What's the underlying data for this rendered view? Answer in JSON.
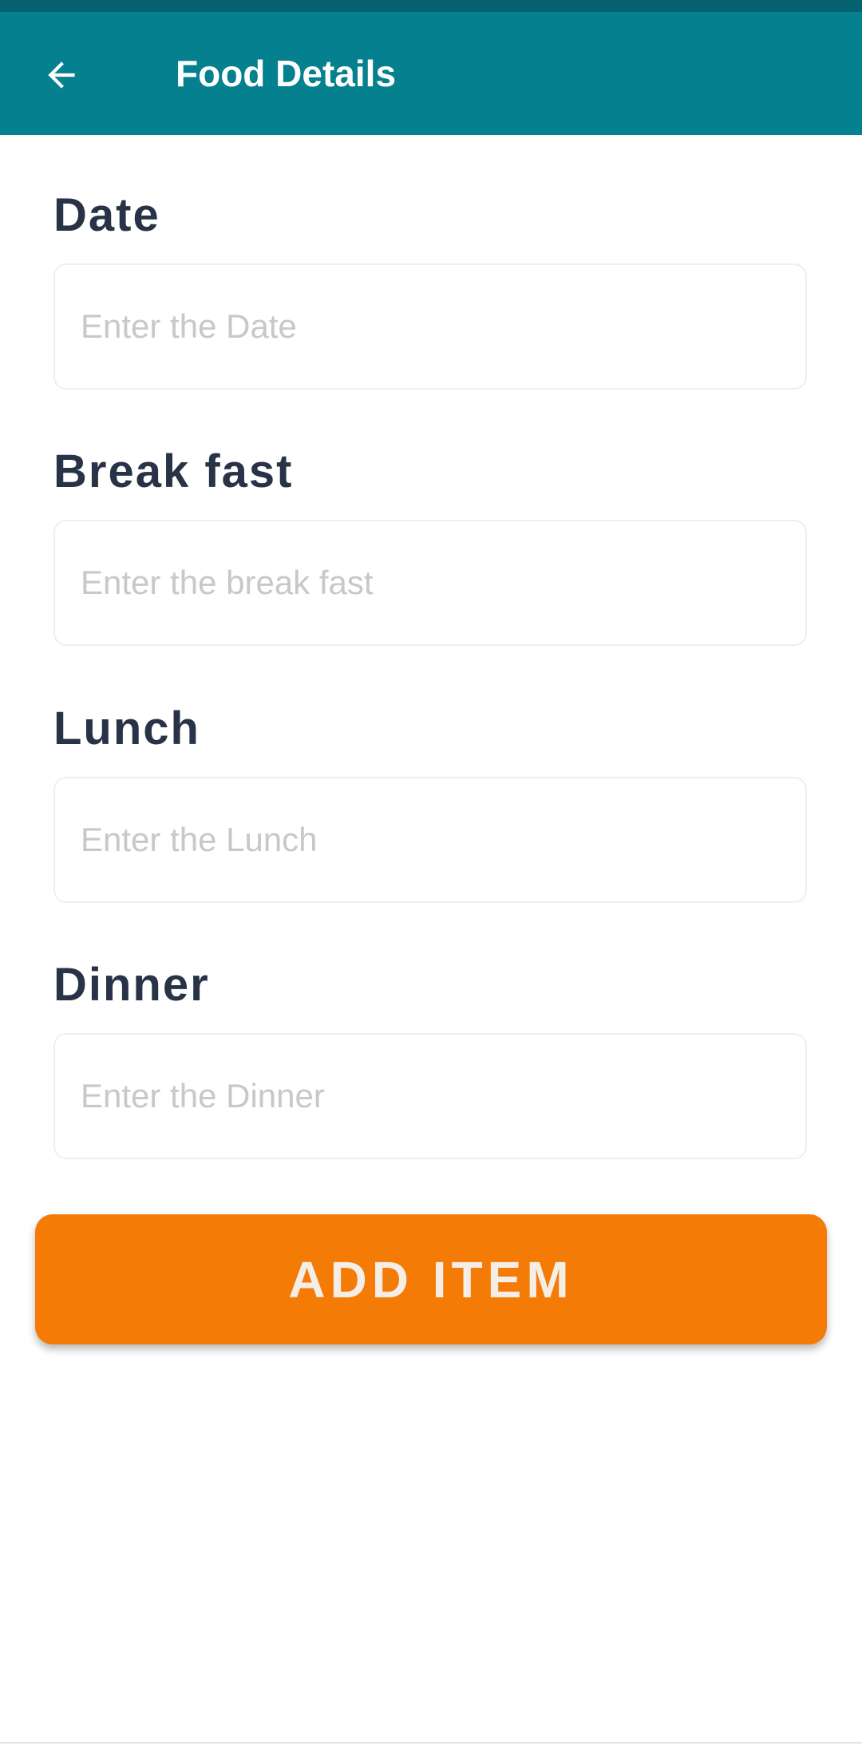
{
  "app_bar": {
    "title": "Food Details",
    "back_icon": "arrow-left-icon",
    "background": "#05808f",
    "status_bar_color": "#05616f"
  },
  "form": {
    "date": {
      "label": "Date",
      "placeholder": "Enter the Date"
    },
    "breakfast": {
      "label": "Break fast",
      "placeholder": "Enter the break fast"
    },
    "lunch": {
      "label": "Lunch",
      "placeholder": "Enter the Lunch"
    },
    "dinner": {
      "label": "Dinner",
      "placeholder": "Enter the Dinner"
    }
  },
  "actions": {
    "add_item_label": "ADD ITEM",
    "add_item_color": "#f47b06"
  }
}
